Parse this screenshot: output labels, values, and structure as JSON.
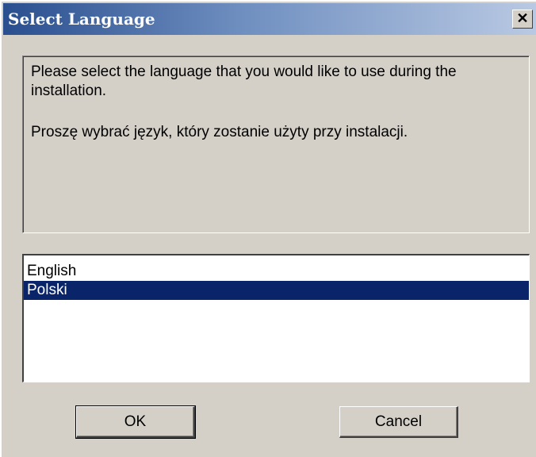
{
  "window": {
    "title": "Select Language",
    "close_glyph": "✕",
    "close_icon": "close-icon"
  },
  "message": {
    "english": "Please select the language that you would like to use during the installation.",
    "polish": "Proszę wybrać język, który zostanie użyty przy instalacji."
  },
  "languages": {
    "items": [
      "English",
      "Polski"
    ],
    "selected": "Polski"
  },
  "buttons": {
    "ok_label": "OK",
    "cancel_label": "Cancel"
  },
  "colors": {
    "dialog_bg": "#d4d0c8",
    "title_gradient_start": "#2a4f8f",
    "title_gradient_end": "#b9c9e3",
    "selection_bg": "#0a246a",
    "selection_text": "#ffffff"
  }
}
